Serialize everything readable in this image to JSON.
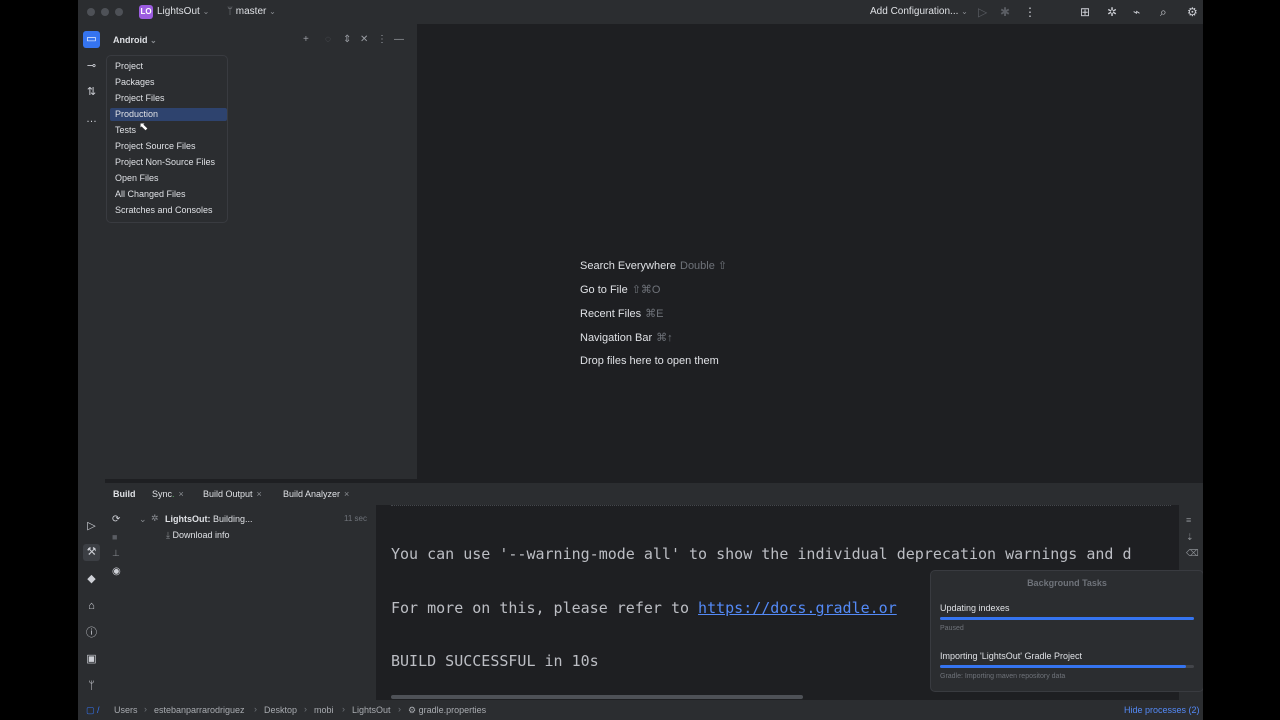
{
  "titlebar": {
    "project_badge": "LO",
    "project_name": "LightsOut",
    "branch": "master",
    "run_config": "Add Configuration...",
    "icons": [
      "play-icon",
      "debug-icon",
      "more-icon",
      "build-variants-icon",
      "bug-icon",
      "device-icon",
      "search-icon",
      "settings-icon"
    ]
  },
  "project_panel": {
    "view_selector": "Android",
    "view_options": [
      "Project",
      "Packages",
      "Project Files",
      "Production",
      "Tests",
      "Project Source Files",
      "Project Non-Source Files",
      "Open Files",
      "All Changed Files",
      "Scratches and Consoles"
    ],
    "selected_option": "Production"
  },
  "editor": {
    "hints": [
      {
        "label": "Search Everywhere",
        "shortcut": "Double ⇧"
      },
      {
        "label": "Go to File",
        "shortcut": "⇧⌘O"
      },
      {
        "label": "Recent Files",
        "shortcut": "⌘E"
      },
      {
        "label": "Navigation Bar",
        "shortcut": "⌘↑"
      },
      {
        "label": "Drop files here to open them",
        "shortcut": ""
      }
    ]
  },
  "build": {
    "title": "Build",
    "tabs": [
      "Sync",
      "Build Output",
      "Build Analyzer"
    ],
    "tree": {
      "root_label": "LightsOut:",
      "root_status": "Building...",
      "root_time": "11 sec",
      "child_label": "Download info"
    },
    "console_lines": [
      "You can use '--warning-mode all' to show the individual deprecation warnings and d",
      "For more on this, please refer to ",
      "BUILD SUCCESSFUL in 10s"
    ],
    "console_link": "https://docs.gradle.or"
  },
  "background_tasks": {
    "title": "Background Tasks",
    "tasks": [
      {
        "name": "Updating indexes",
        "status": "Paused",
        "progress": 1.0
      },
      {
        "name": "Importing 'LightsOut' Gradle Project",
        "status": "Gradle: Importing maven repository data",
        "progress": 0.97
      }
    ]
  },
  "statusbar": {
    "breadcrumbs": [
      "Users",
      "estebanparrarodriguez",
      "Desktop",
      "mobi",
      "LightsOut",
      "gradle.properties"
    ],
    "hide_processes": "Hide processes (2)"
  },
  "colors": {
    "accent": "#3574f0",
    "selection": "#2e436e",
    "link": "#548af7",
    "badge": "#9c5de0"
  }
}
